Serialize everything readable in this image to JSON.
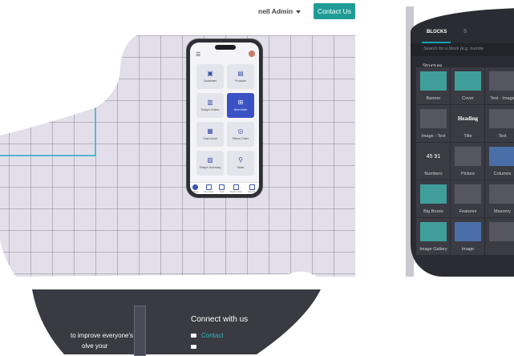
{
  "header": {
    "admin_label": "nell Admin",
    "contact_button": "Contact Us"
  },
  "phone": {
    "tiles": [
      {
        "label": "Customers",
        "icon": "users-icon"
      },
      {
        "label": "Products",
        "icon": "box-icon"
      },
      {
        "label": "Today's Orders",
        "icon": "clipboard-icon"
      },
      {
        "label": "New Order",
        "icon": "plus-document-icon",
        "active": true
      },
      {
        "label": "Cash-in/out",
        "icon": "cash-icon"
      },
      {
        "label": "Return Order",
        "icon": "return-icon"
      },
      {
        "label": "Today's Summary",
        "icon": "summary-icon"
      },
      {
        "label": "Mode",
        "icon": "mode-icon"
      }
    ],
    "nav": [
      "Home",
      "New Order",
      "Cash",
      "Return Order",
      "Summary"
    ]
  },
  "editor": {
    "tab_blocks": "BLOCKS",
    "tab_second": "S",
    "search_placeholder": "Search for a block (e.g. numbe",
    "section_title": "Structure",
    "blocks": [
      {
        "label": "Banner"
      },
      {
        "label": "Cover"
      },
      {
        "label": "Text - Image"
      },
      {
        "label": "Image - Text"
      },
      {
        "label": "Title",
        "heading": "Heading"
      },
      {
        "label": "Text"
      },
      {
        "label": "Numbers",
        "numbers": "45 91"
      },
      {
        "label": "Picture"
      },
      {
        "label": "Columns"
      },
      {
        "label": "Big Boxes"
      },
      {
        "label": "Features"
      },
      {
        "label": "Masonry"
      },
      {
        "label": "Image Gallery"
      },
      {
        "label": "Image"
      },
      {
        "label": ""
      }
    ]
  },
  "footer": {
    "connect_title": "Connect with us",
    "contact_link": "Contact",
    "line1": "to improve everyone's",
    "line2": "olve your"
  },
  "colors": {
    "accent": "#1f9c96",
    "grid_bg": "#e2dfea",
    "panel_bg": "#2b2c33",
    "footer_bg": "#393a42",
    "link": "#38b6c9",
    "active_tile": "#3a52c4"
  }
}
